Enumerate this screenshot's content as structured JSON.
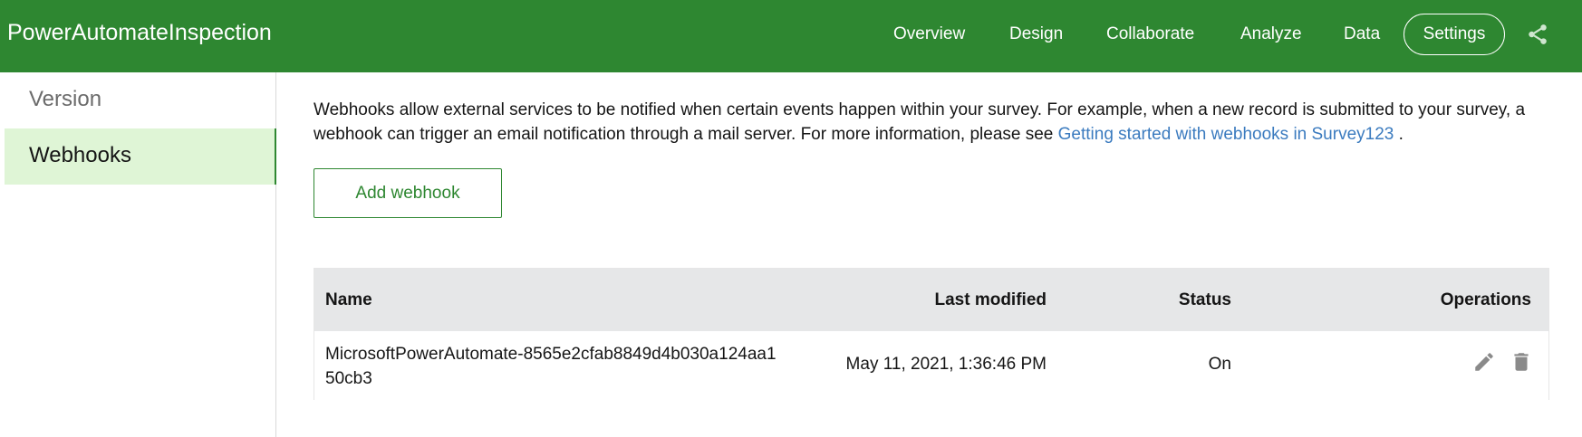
{
  "header": {
    "app_title": "PowerAutomateInspection",
    "nav": [
      "Overview",
      "Design",
      "Collaborate",
      "Analyze",
      "Data"
    ],
    "settings_label": "Settings",
    "share_icon": "share-icon",
    "brand_color": "#2e8731"
  },
  "sidebar": {
    "items": [
      {
        "label": "Version",
        "active": false
      },
      {
        "label": "Webhooks",
        "active": true
      }
    ]
  },
  "main": {
    "description_prefix": "Webhooks allow external services to be notified when certain events happen within your survey. For example, when a new record is submitted to your survey, a webhook can trigger an email notification through a mail server. For more information, please see ",
    "description_link": "Getting started with webhooks in Survey123",
    "description_suffix": " .",
    "add_button": "Add webhook",
    "table": {
      "columns": [
        "Name",
        "Last modified",
        "Status",
        "Operations"
      ],
      "rows": [
        {
          "name_line1": "MicrosoftPowerAutomate-8565e2cfab8849d4b030a124aa1",
          "name_line2": "50cb3",
          "last_modified": "May 11, 2021, 1:36:46 PM",
          "status": "On",
          "operations": [
            "edit-icon",
            "delete-icon"
          ]
        }
      ]
    }
  }
}
